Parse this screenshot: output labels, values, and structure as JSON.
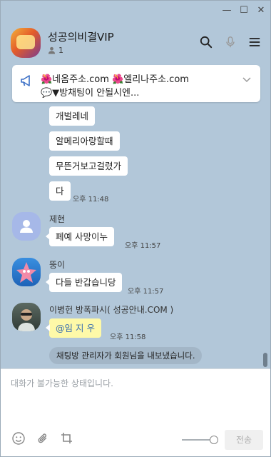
{
  "window": {
    "minimize": "—",
    "maximize": "☐",
    "close": "✕"
  },
  "header": {
    "title": "성공의비결VIP",
    "member_count": "1"
  },
  "notice": {
    "line1": "🌺네옴주소.com  🌺엘리나주소.com",
    "line2": "💬▼방채팅이 안될시엔..."
  },
  "messages": [
    {
      "text": "개벌레네"
    },
    {
      "text": "알메리아랑할때"
    },
    {
      "text": "무뜬거보고걸렸가"
    },
    {
      "text": "다",
      "time": "오후 11:48"
    }
  ],
  "users": [
    {
      "name": "제현",
      "text": "폐예  사망이누",
      "time": "오후 11:57"
    },
    {
      "name": "뚱이",
      "text": "다들 반갑습니당",
      "time": "오후 11:57"
    },
    {
      "name": "이병헌 방폭파시( 성공안내.COM )",
      "text": "@임 지 우",
      "time": "오후 11:58"
    }
  ],
  "system_message": "채팅방 관리자가 회원님을 내보냈습니다.",
  "input": {
    "placeholder": "대화가 불가능한 상태입니다.",
    "send_label": "전송"
  },
  "colors": {
    "chat_background": "#b2c7d9",
    "mention_highlight": "#fef9a8",
    "mention_text": "#3a6fb0"
  }
}
